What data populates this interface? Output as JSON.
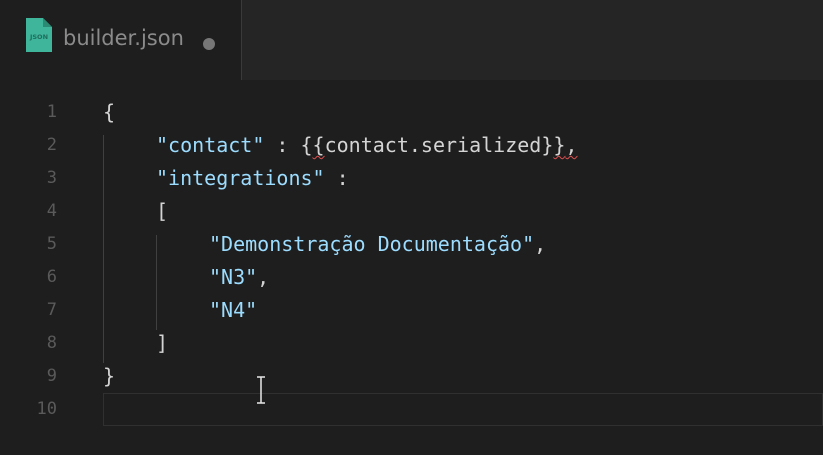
{
  "tab": {
    "filename": "builder.json",
    "icon": "json-file-icon",
    "modified": true
  },
  "editor": {
    "lines": [
      {
        "number": "1",
        "tokens": [
          {
            "text": "{",
            "kind": "punct"
          }
        ]
      },
      {
        "number": "2",
        "tokens": [
          {
            "text": "\"contact\"",
            "kind": "key"
          },
          {
            "text": " : {",
            "kind": "punct"
          },
          {
            "text": "{",
            "kind": "punct",
            "squiggle": true
          },
          {
            "text": "contact.serialized}",
            "kind": "punct"
          },
          {
            "text": "}",
            "kind": "punct",
            "squiggle": true
          },
          {
            "text": ",",
            "kind": "punct",
            "squiggle": true
          }
        ]
      },
      {
        "number": "3",
        "tokens": [
          {
            "text": "\"integrations\"",
            "kind": "key"
          },
          {
            "text": " :",
            "kind": "punct"
          }
        ]
      },
      {
        "number": "4",
        "tokens": [
          {
            "text": "[",
            "kind": "punct"
          }
        ]
      },
      {
        "number": "5",
        "tokens": [
          {
            "text": "\"Demonstração Documentação\"",
            "kind": "str"
          },
          {
            "text": ",",
            "kind": "punct"
          }
        ]
      },
      {
        "number": "6",
        "tokens": [
          {
            "text": "\"N3\"",
            "kind": "str"
          },
          {
            "text": ",",
            "kind": "punct"
          }
        ]
      },
      {
        "number": "7",
        "tokens": [
          {
            "text": "\"N4\"",
            "kind": "str"
          }
        ]
      },
      {
        "number": "8",
        "tokens": [
          {
            "text": "]",
            "kind": "punct"
          }
        ]
      },
      {
        "number": "9",
        "tokens": [
          {
            "text": "}",
            "kind": "punct"
          }
        ]
      },
      {
        "number": "10",
        "tokens": []
      }
    ]
  },
  "colors": {
    "background": "#1e1e1e",
    "key": "#9cdcfe",
    "string": "#9cdcfe",
    "punctuation": "#d4d4d4",
    "line_number": "#5a5a5a",
    "tab_label": "#8b8b8b",
    "json_icon": "#3fb59c"
  }
}
